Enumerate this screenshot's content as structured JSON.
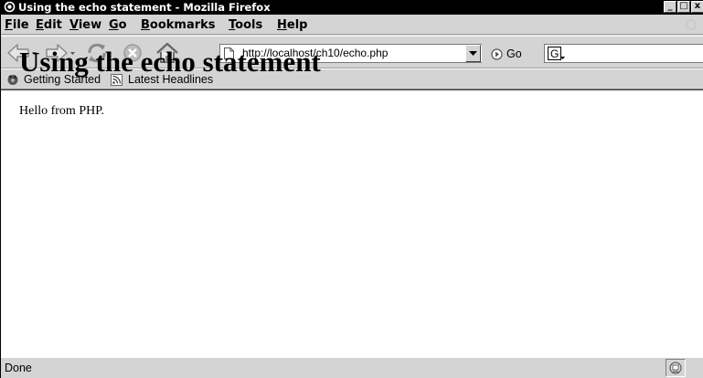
{
  "window": {
    "title": "Using the echo statement - Mozilla Firefox",
    "controls": {
      "minimize": "_",
      "maximize": "□",
      "close": "x"
    }
  },
  "menubar": {
    "items": [
      {
        "label": "File",
        "accel": "F",
        "rest": "ile"
      },
      {
        "label": "Edit",
        "accel": "E",
        "rest": "dit"
      },
      {
        "label": "View",
        "accel": "V",
        "rest": "iew"
      },
      {
        "label": "Go",
        "accel": "G",
        "rest": "o"
      },
      {
        "label": "Bookmarks",
        "accel": "B",
        "rest": "ookmarks"
      },
      {
        "label": "Tools",
        "accel": "T",
        "rest": "ools"
      },
      {
        "label": "Help",
        "accel": "H",
        "rest": "elp"
      }
    ]
  },
  "navbar": {
    "url": "http://localhost/ch10/echo.php",
    "go_label": "Go",
    "search_value": "",
    "icons": [
      "back-icon",
      "forward-icon",
      "reload-icon",
      "stop-icon",
      "home-icon"
    ]
  },
  "bookmarks": {
    "items": [
      {
        "label": "Getting Started",
        "icon": "getting-started-icon"
      },
      {
        "label": "Latest Headlines",
        "icon": "rss-icon"
      }
    ]
  },
  "page": {
    "heading": "Using the echo statement",
    "body_text": "Hello from PHP."
  },
  "statusbar": {
    "text": "Done"
  },
  "colors": {
    "chrome": "#d4d4d4",
    "titlebar": "#000000",
    "content": "#ffffff"
  }
}
